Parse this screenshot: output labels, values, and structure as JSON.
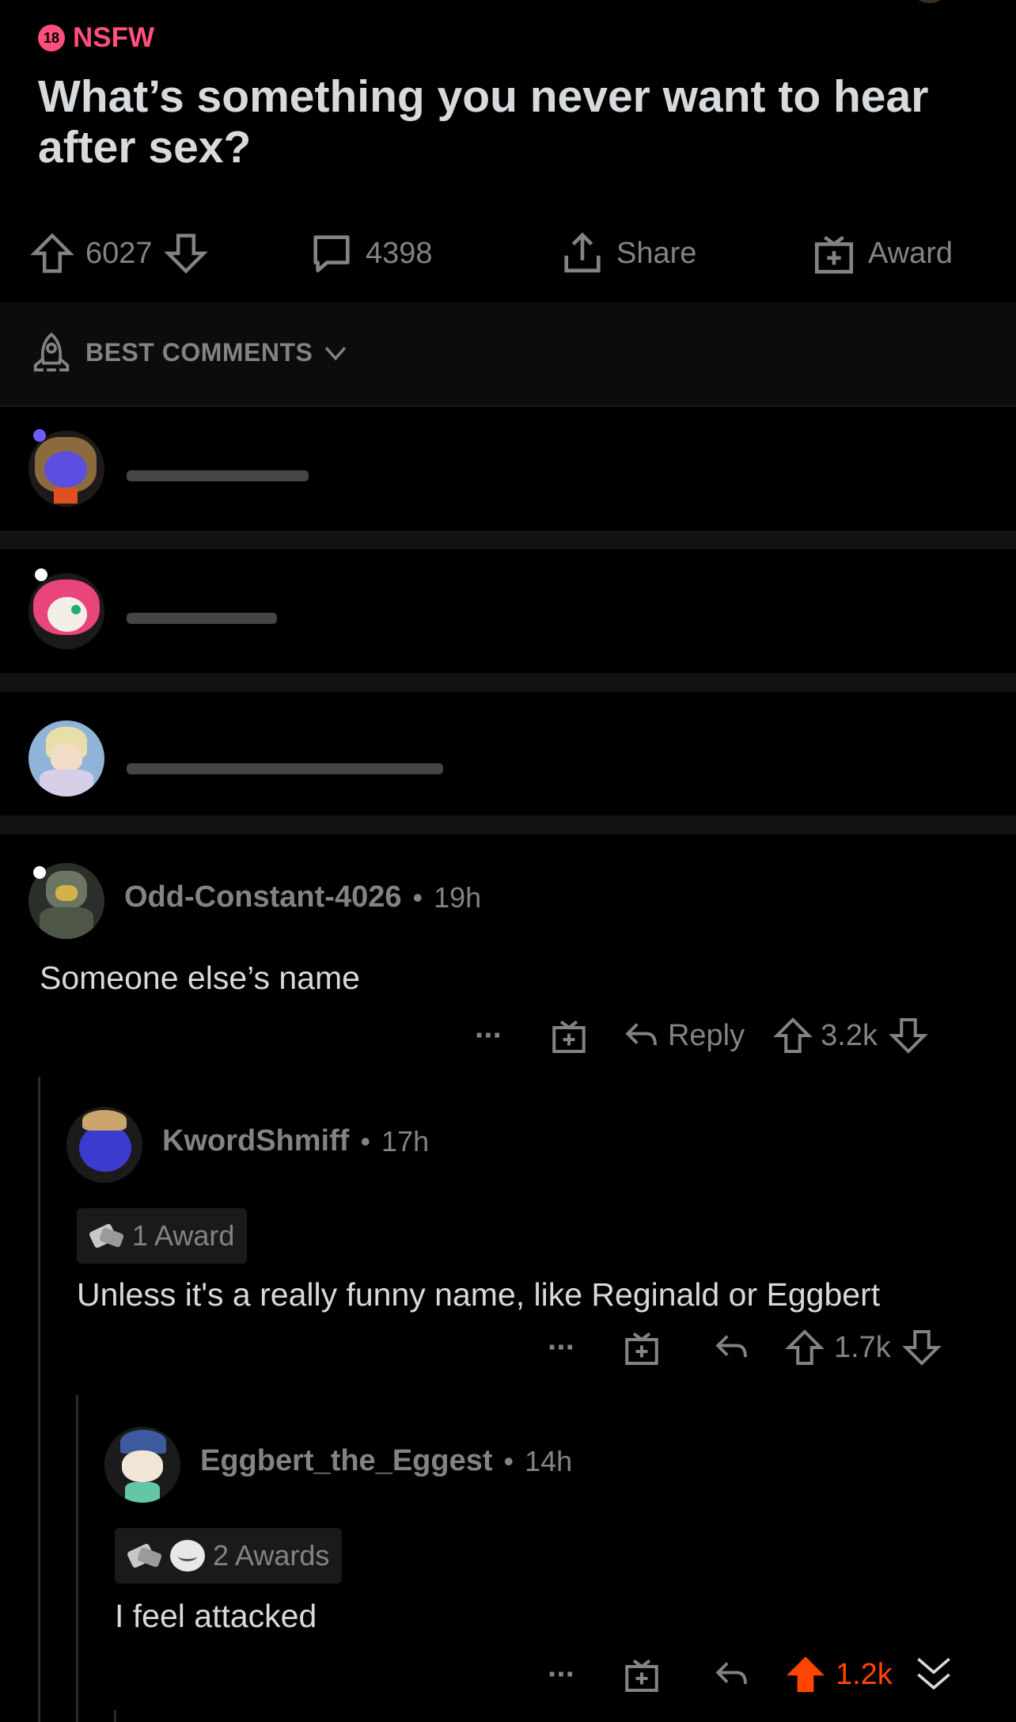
{
  "post": {
    "nsfw_badge": "18",
    "nsfw_label": "NSFW",
    "title": "What’s something you never want to hear after sex?",
    "upvotes": "6027",
    "comments": "4398",
    "share_label": "Share",
    "award_label": "Award"
  },
  "sort": {
    "label": "BEST COMMENTS"
  },
  "comments": [
    {
      "username": "Odd-Constant-4026",
      "age": "19h",
      "body": "Someone else’s name",
      "reply_label": "Reply",
      "score": "3.2k"
    },
    {
      "username": "KwordShmiff",
      "age": "17h",
      "awards": "1 Award",
      "body": "Unless it's a really funny name, like Reginald or Eggbert",
      "score": "1.7k"
    },
    {
      "username": "Eggbert_the_Eggest",
      "age": "14h",
      "awards": "2 Awards",
      "body": "I feel attacked",
      "score": "1.2k"
    }
  ],
  "colors": {
    "accent_nsfw": "#ff4f7b",
    "upvote_orange": "#ff4500",
    "background": "#000000"
  },
  "more_menu": "···",
  "meta_dot": "•"
}
